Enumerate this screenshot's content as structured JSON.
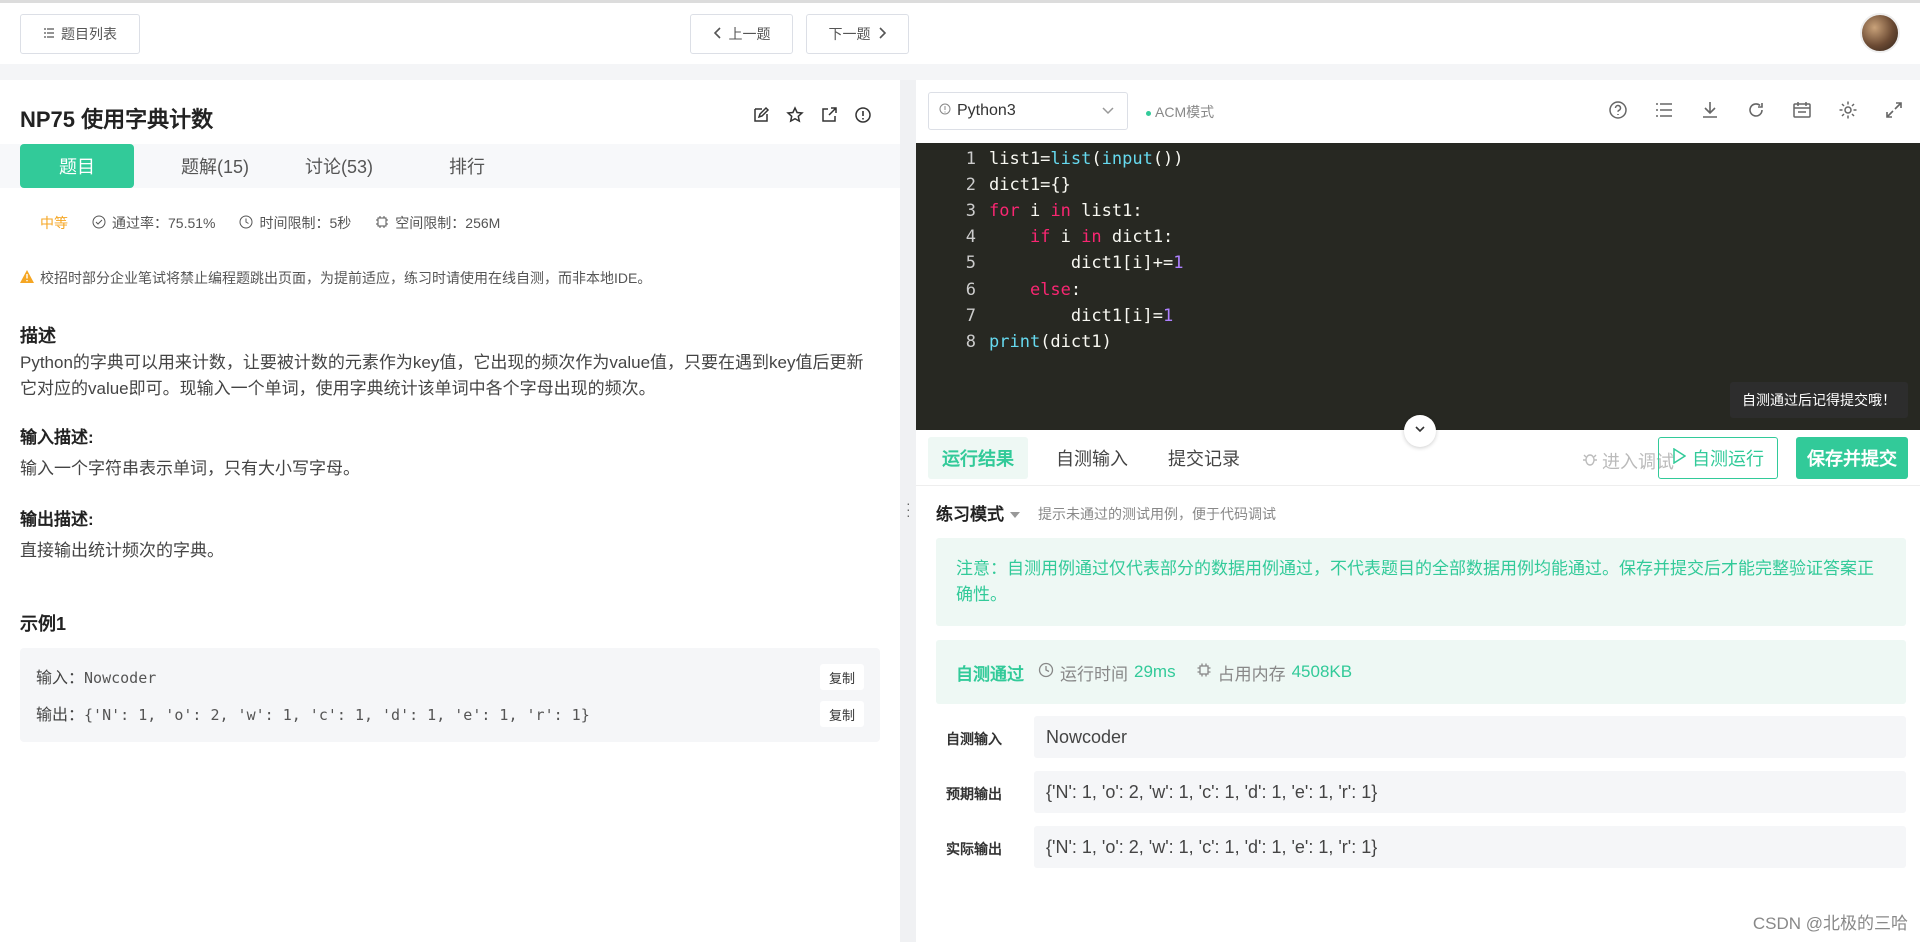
{
  "topbar": {
    "problem_list": "题目列表",
    "prev": "上一题",
    "next": "下一题"
  },
  "problem": {
    "title": "NP75  使用字典计数",
    "tabs": [
      "题目",
      "题解(15)",
      "讨论(53)",
      "排行"
    ],
    "difficulty": "中等",
    "pass_rate": "通过率：75.51%",
    "time_limit": "时间限制：5秒",
    "space_limit": "空间限制：256M",
    "warning": "校招时部分企业笔试将禁止编程题跳出页面，为提前适应，练习时请使用在线自测，而非本地IDE。",
    "desc_heading": "描述",
    "desc": "Python的字典可以用来计数，让要被计数的元素作为key值，它出现的频次作为value值，只要在遇到key值后更新它对应的value即可。现输入一个单词，使用字典统计该单词中各个字母出现的频次。",
    "input_heading": "输入描述:",
    "input_desc": "输入一个字符串表示单词，只有大小写字母。",
    "output_heading": "输出描述:",
    "output_desc": "直接输出统计频次的字典。",
    "example_heading": "示例1",
    "example_input_label": "输入：",
    "example_input": "Nowcoder",
    "example_output_label": "输出：",
    "example_output": "{'N': 1, 'o': 2, 'w': 1, 'c': 1, 'd': 1, 'e': 1, 'r': 1}",
    "copy": "复制"
  },
  "editor": {
    "language": "Python3",
    "mode": "ACM模式",
    "line_numbers": [
      "1",
      "2",
      "3",
      "4",
      "5",
      "6",
      "7",
      "8"
    ],
    "tooltip": "自测通过后记得提交哦！"
  },
  "run": {
    "tabs": [
      "运行结果",
      "自测输入",
      "提交记录"
    ],
    "debug": "进入调试",
    "run_button": "自测运行",
    "submit_button": "保存并提交",
    "practice_mode": "练习模式",
    "practice_hint": "提示未通过的测试用例，便于代码调试",
    "notice": "注意：自测用例通过仅代表部分的数据用例通过，不代表题目的全部数据用例均能通过。保存并提交后才能完整验证答案正确性。",
    "status": "自测通过",
    "runtime_label": "运行时间",
    "runtime": "29ms",
    "memory_label": "占用内存",
    "memory": "4508KB",
    "self_input_label": "自测输入",
    "self_input": "Nowcoder",
    "expected_label": "预期输出",
    "expected": "{'N': 1, 'o': 2, 'w': 1, 'c': 1, 'd': 1, 'e': 1, 'r': 1}",
    "actual_label": "实际输出",
    "actual": "{'N': 1, 'o': 2, 'w': 1, 'c': 1, 'd': 1, 'e': 1, 'r': 1}"
  },
  "watermark": "CSDN @北极的三哈",
  "colors": {
    "accent": "#32ca99",
    "difficulty": "#f5a623",
    "editor_bg": "#272822"
  }
}
